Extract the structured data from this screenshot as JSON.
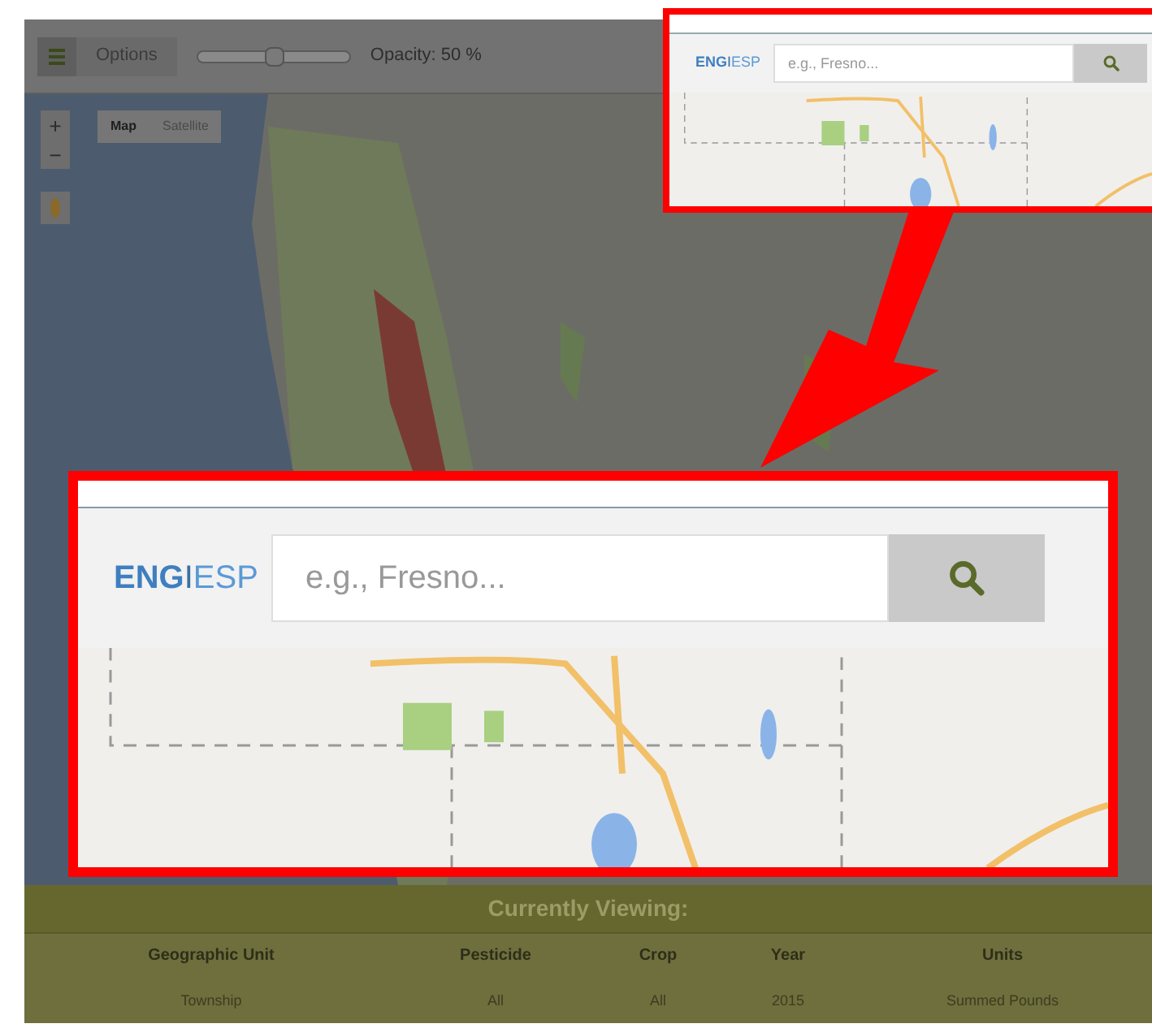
{
  "toolbar": {
    "options_label": "Options",
    "opacity": {
      "label": "Opacity: 50 %",
      "level": 0.5
    }
  },
  "map_controls": {
    "zoom_in": "+",
    "zoom_out": "−",
    "map_types": [
      {
        "label": "Map",
        "selected": true
      },
      {
        "label": "Satellite",
        "selected": false
      }
    ]
  },
  "callouts": {
    "small": {
      "languages": [
        {
          "label": "ENG",
          "selected": true
        },
        {
          "label": "ESP",
          "selected": false
        }
      ],
      "separator": "I",
      "search": {
        "placeholder": "e.g., Fresno..."
      }
    },
    "large": {
      "languages": [
        {
          "label": "ENG",
          "selected": true
        },
        {
          "label": "ESP",
          "selected": false
        }
      ],
      "separator": "I",
      "search": {
        "placeholder": "e.g., Fresno..."
      }
    }
  },
  "summary": {
    "title": "Currently Viewing:",
    "columns": [
      "Geographic Unit",
      "Pesticide",
      "Crop",
      "Year",
      "Units"
    ],
    "row": [
      "Township",
      "All",
      "All",
      "2015",
      "Summed Pounds"
    ]
  }
}
